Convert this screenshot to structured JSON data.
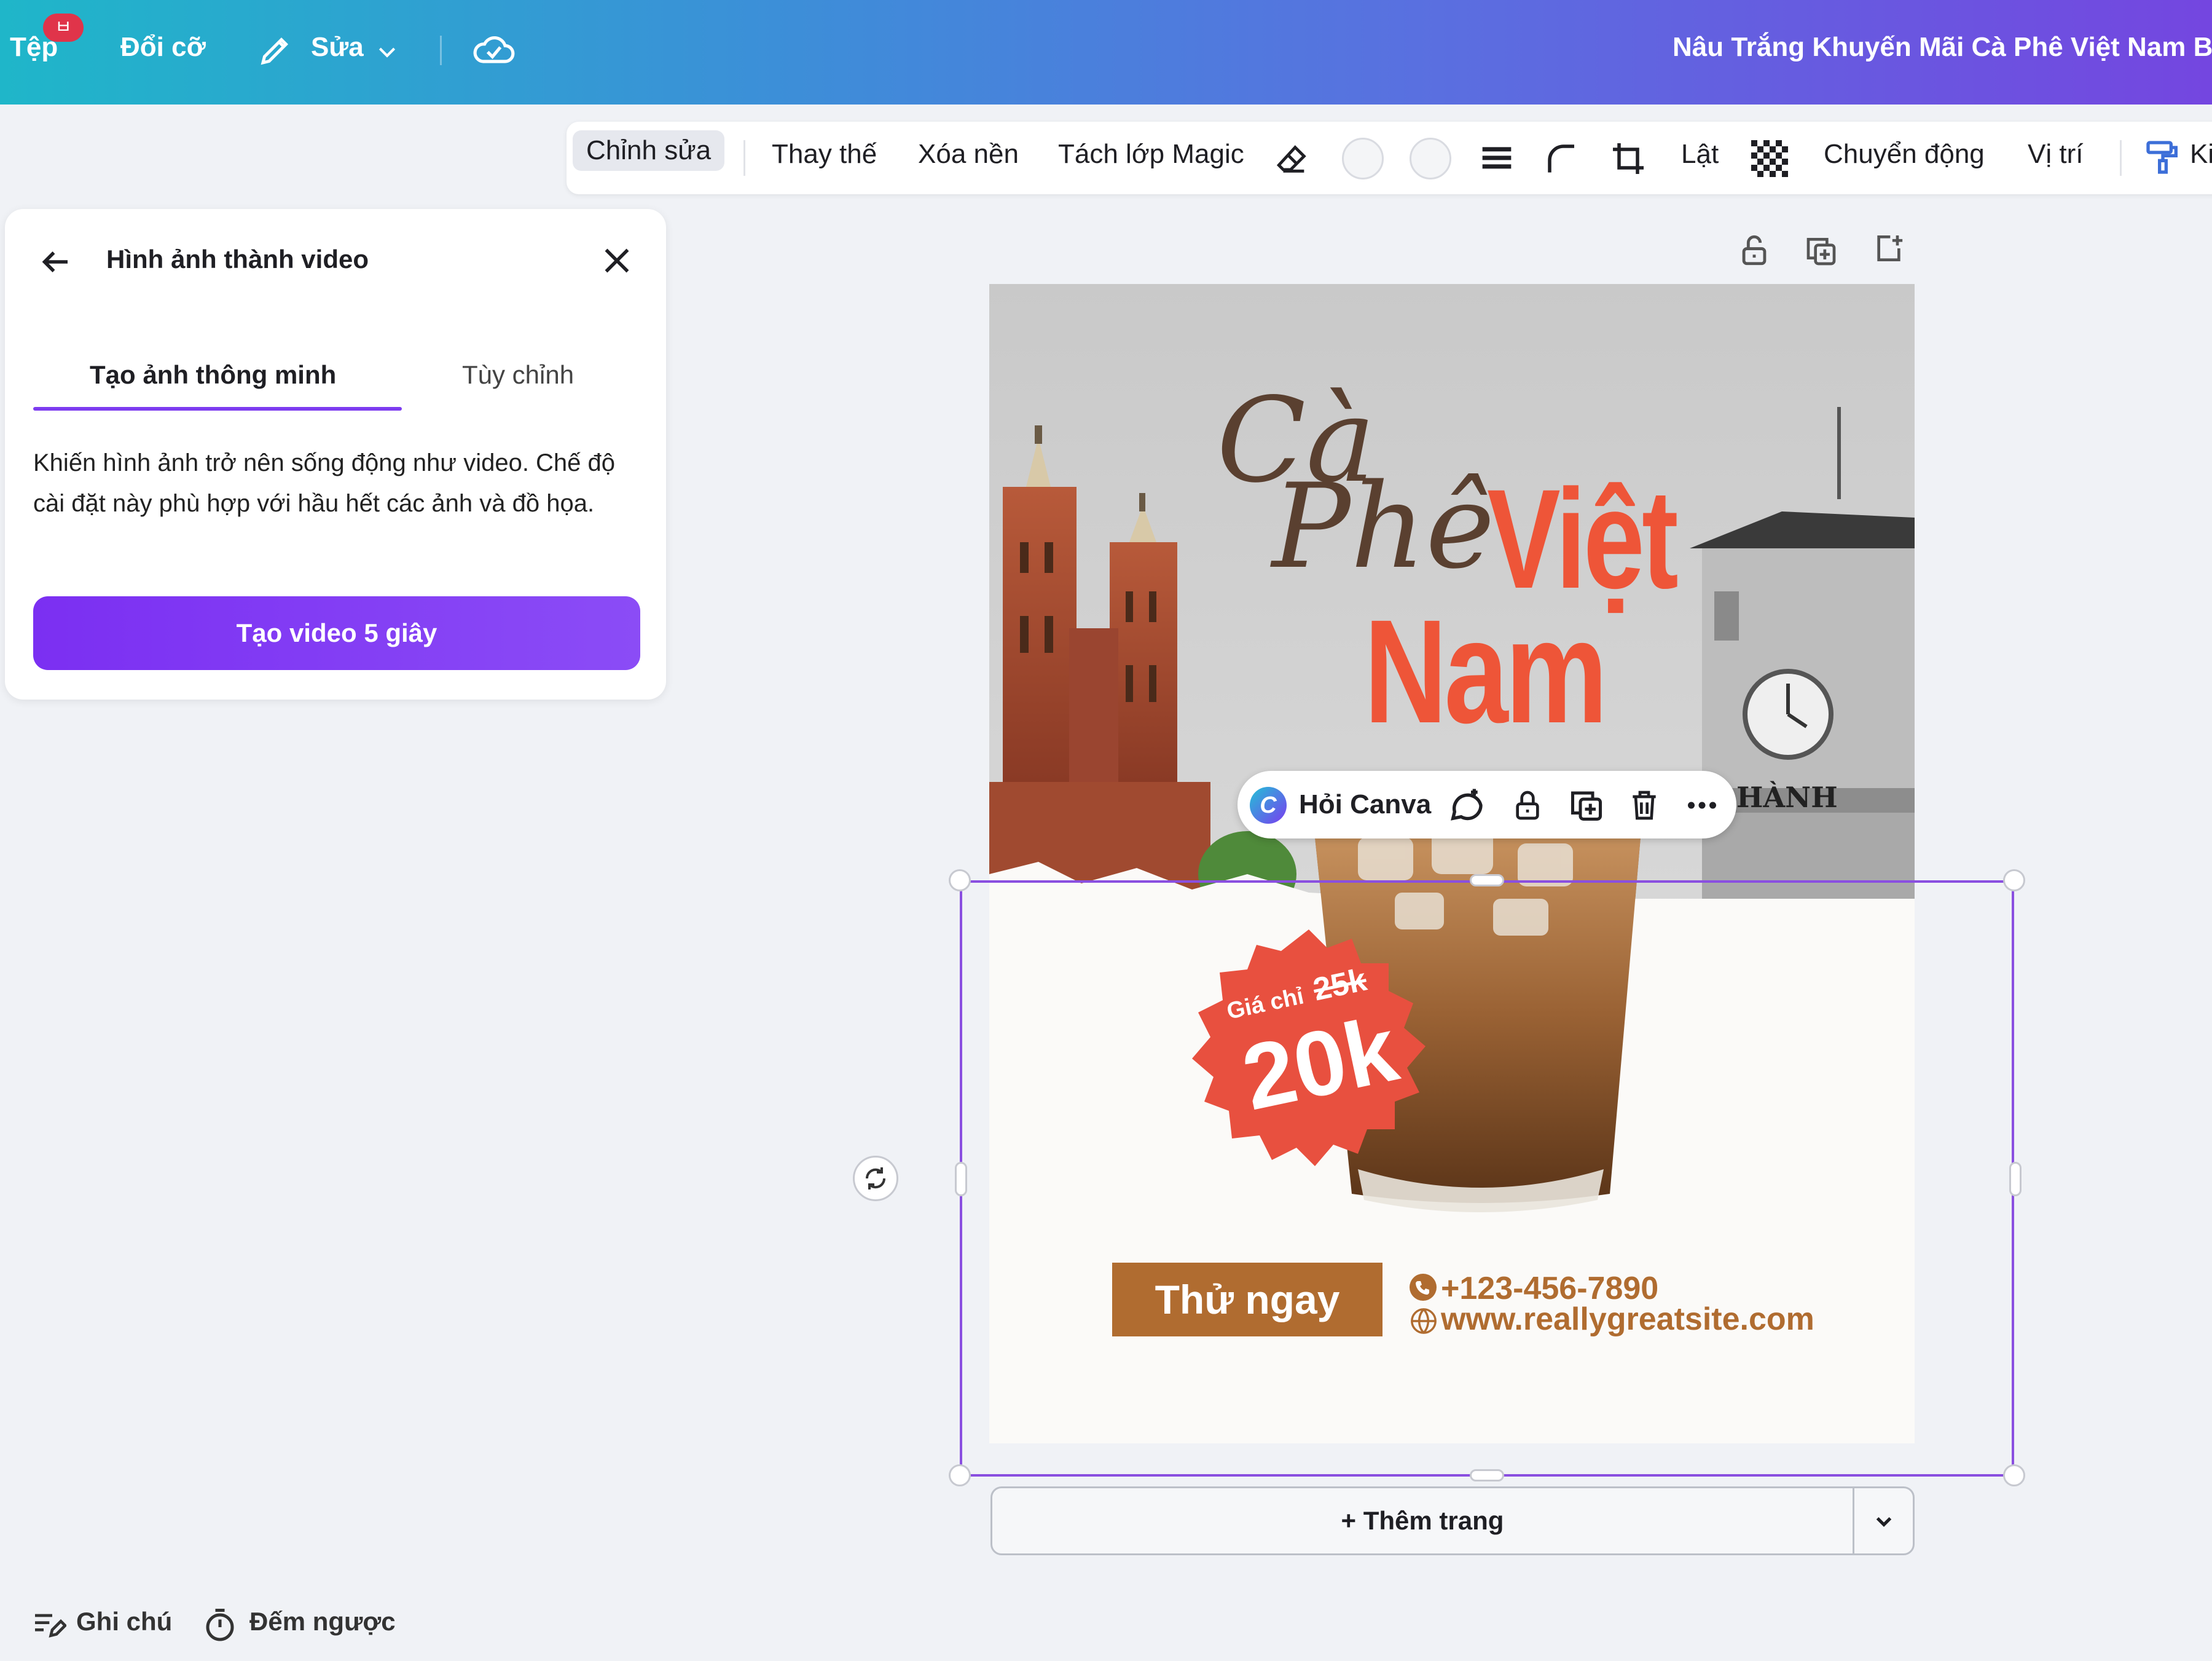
{
  "topbar": {
    "file_label": "Tệp",
    "badge": "ㅂ",
    "resize_label": "Đổi cỡ",
    "edit_label": "Sửa",
    "doc_title": "Nâu Trắng Khuyến Mãi Cà Phê Việt Nam Bả"
  },
  "toolbar": {
    "edit": "Chỉnh sửa",
    "replace": "Thay thế",
    "remove_bg": "Xóa nền",
    "magic_layer": "Tách lớp Magic",
    "flip": "Lật",
    "animate": "Chuyển động",
    "position": "Vị trí",
    "copy_style": "Ki"
  },
  "panel": {
    "title": "Hình ảnh thành video",
    "tabs": [
      "Tạo ảnh thông minh",
      "Tùy chỉnh"
    ],
    "description": "Khiến hình ảnh trở nên sống động như video. Chế độ cài đặt này phù hợp với hầu hết các ảnh và đồ họa.",
    "cta": "Tạo video 5 giây"
  },
  "design": {
    "title_script_1": "Cà",
    "title_script_2": "Phê",
    "title_bold_1": "Việt",
    "title_bold_2": "Nam",
    "price_prefix": "Giá chỉ",
    "old_price": "25k",
    "new_price": "20k",
    "cta": "Thử ngay",
    "phone": "+123-456-7890",
    "website": "www.reallygreatsite.com",
    "sign_text": "HÀNH"
  },
  "float_toolbar": {
    "ask_canva": "Hỏi Canva"
  },
  "add_page": "+ Thêm trang",
  "footer": {
    "notes": "Ghi chú",
    "timer": "Đếm ngược"
  },
  "colors": {
    "accent": "#7d3cf0",
    "selection": "#8a4fe0",
    "brand_brown": "#b06c30",
    "badge_red": "#e8503f"
  }
}
